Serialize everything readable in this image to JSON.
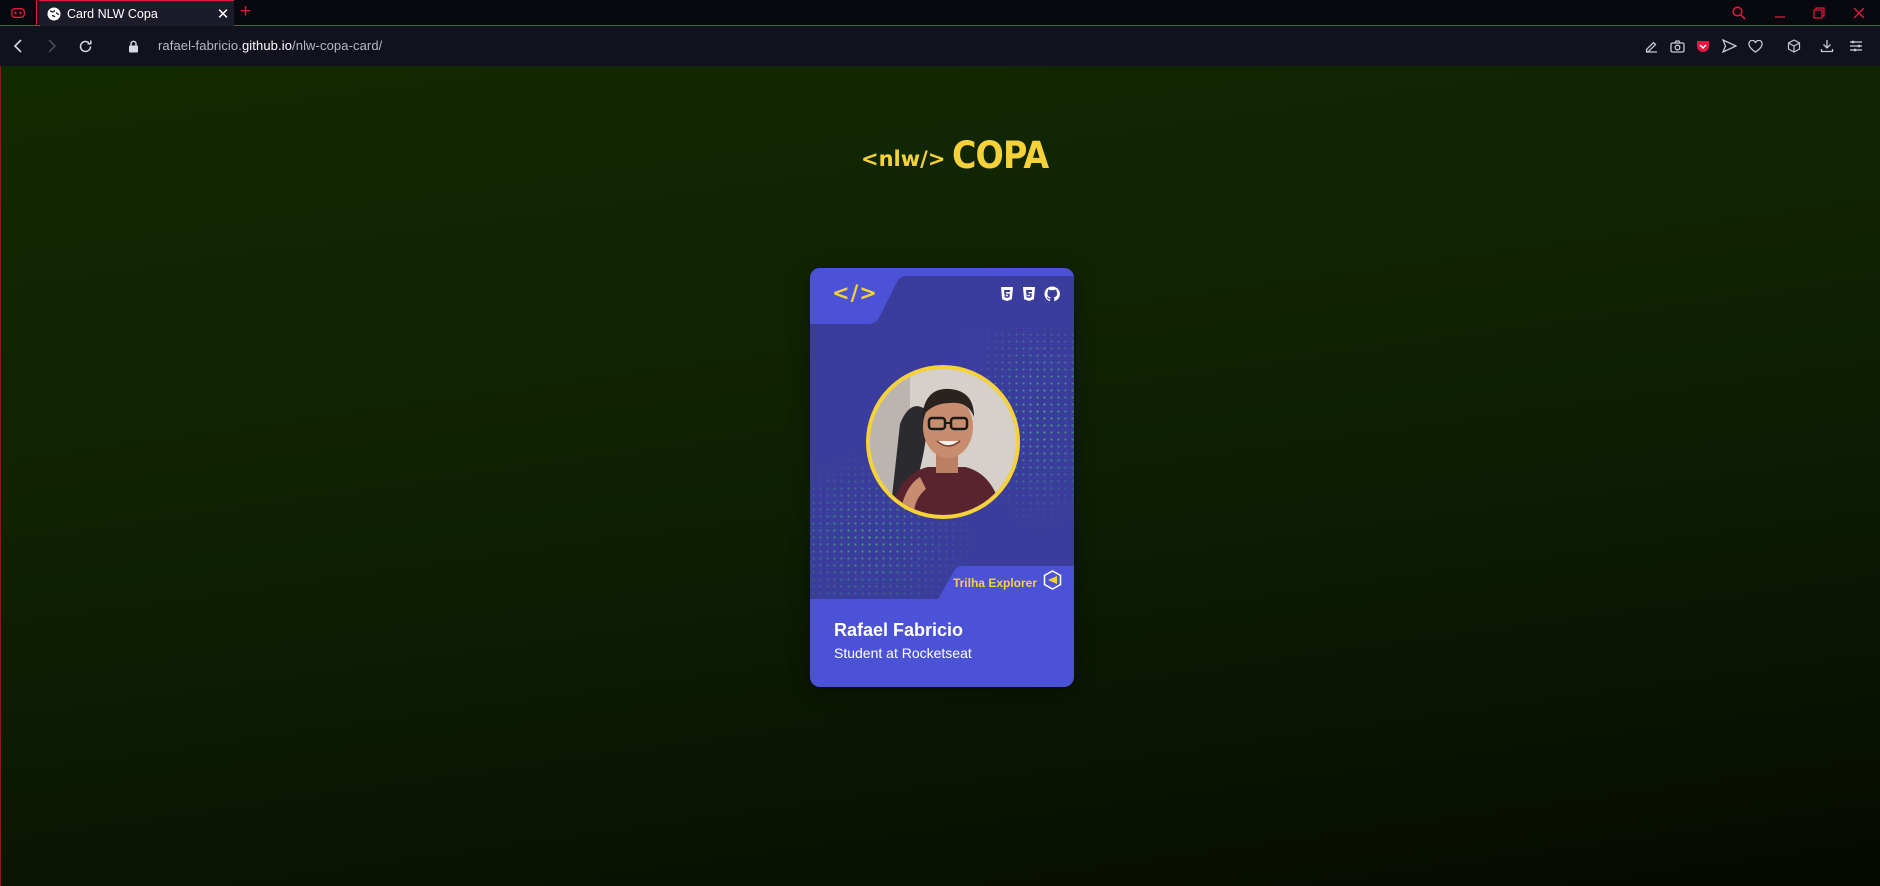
{
  "browser": {
    "tab": {
      "title": "Card NLW Copa"
    },
    "url": {
      "prefix": "rafael-fabricio.",
      "host": "github.io",
      "path": "/nlw-copa-card/"
    },
    "accent_color": "#e5193f"
  },
  "page": {
    "logo": {
      "code": "<nlw/>",
      "word": "COPA"
    },
    "card": {
      "code_icon": "</>",
      "tech_icons": [
        "html5-icon",
        "css3-icon",
        "github-icon"
      ],
      "track_label": "Trilha Explorer",
      "name": "Rafael Fabricio",
      "role": "Student at Rocketseat",
      "colors": {
        "primary": "#4b52d6",
        "dark": "#3a3d9c",
        "accent": "#f5d13a",
        "dots": "#3fb26a"
      }
    },
    "background_color": "#122a02"
  }
}
